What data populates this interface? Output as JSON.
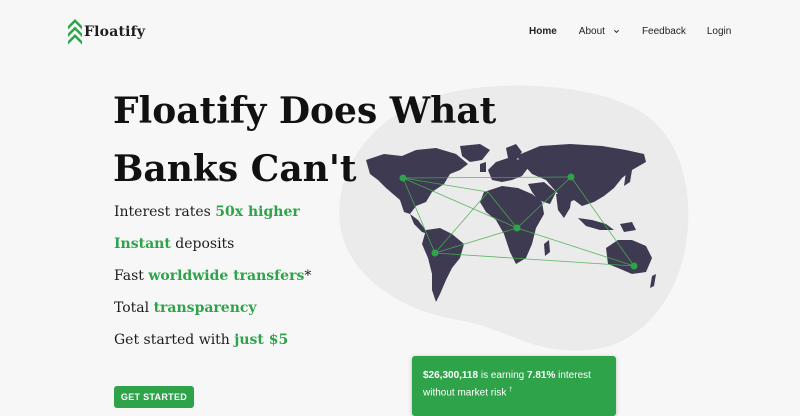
{
  "brand": {
    "name": "Floatify",
    "color": "#2ea34a"
  },
  "nav": {
    "home": "Home",
    "about": "About",
    "feedback": "Feedback",
    "login": "Login"
  },
  "hero": {
    "title_line1": "Floatify Does What",
    "title_line2": "Banks Can't",
    "features": [
      {
        "prefix": "Interest rates ",
        "highlight": "50x higher",
        "suffix": ""
      },
      {
        "prefix": "",
        "highlight": "Instant",
        "suffix": " deposits"
      },
      {
        "prefix": "Fast ",
        "highlight": "worldwide transfers",
        "suffix": "*"
      },
      {
        "prefix": "Total ",
        "highlight": "transparency",
        "suffix": ""
      },
      {
        "prefix": "Get started with ",
        "highlight": "just $5",
        "suffix": ""
      }
    ],
    "cta_label": "GET STARTED"
  },
  "earnings_card": {
    "amount": "$26,300,118",
    "text1": " is earning ",
    "rate": "7.81%",
    "text2": " interest",
    "line2": "without market risk ",
    "footnote_mark": "†"
  },
  "icons": {
    "logo": "chevron-up-stack-icon",
    "about_dropdown": "chevron-down-icon",
    "map": "world-map-icon"
  }
}
